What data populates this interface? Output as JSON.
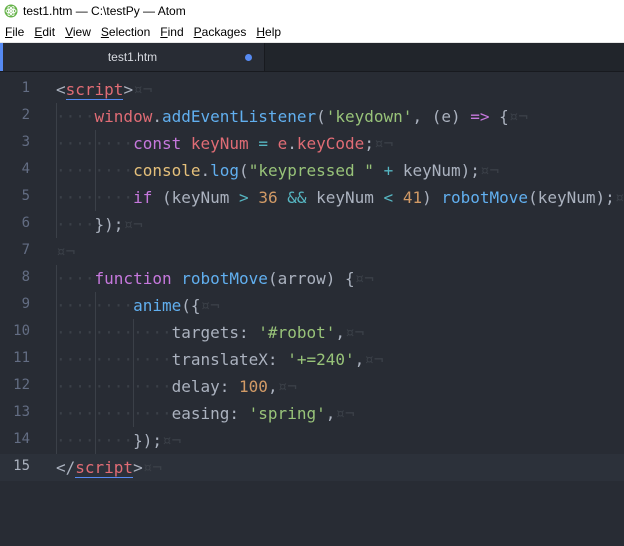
{
  "window": {
    "title": "test1.htm — C:\\testPy — Atom"
  },
  "menu": [
    {
      "mnemonic": "F",
      "rest": "ile"
    },
    {
      "mnemonic": "E",
      "rest": "dit"
    },
    {
      "mnemonic": "V",
      "rest": "iew"
    },
    {
      "mnemonic": "S",
      "rest": "election"
    },
    {
      "mnemonic": "F",
      "rest": "ind"
    },
    {
      "mnemonic": "P",
      "rest": "ackages"
    },
    {
      "mnemonic": "H",
      "rest": "elp"
    }
  ],
  "tab": {
    "label": "test1.htm",
    "modified": true
  },
  "editor": {
    "current_line": 15,
    "eol_marker": "¤¬",
    "indent_marker": "····",
    "lines": [
      {
        "n": "1",
        "indent": 0,
        "tokens": [
          [
            "p",
            "<"
          ],
          [
            "t",
            "script"
          ],
          [
            "p",
            ">"
          ]
        ]
      },
      {
        "n": "2",
        "indent": 1,
        "tokens": [
          [
            "t",
            "window"
          ],
          [
            "p",
            "."
          ],
          [
            "f",
            "addEventListener"
          ],
          [
            "p",
            "("
          ],
          [
            "s",
            "'keydown'"
          ],
          [
            "p",
            ", (e) "
          ],
          [
            "k",
            "=>"
          ],
          [
            "p",
            " {"
          ]
        ]
      },
      {
        "n": "3",
        "indent": 2,
        "tokens": [
          [
            "k",
            "const"
          ],
          [
            "p",
            " "
          ],
          [
            "t",
            "keyNum"
          ],
          [
            "p",
            " "
          ],
          [
            "o",
            "="
          ],
          [
            "p",
            " "
          ],
          [
            "t",
            "e"
          ],
          [
            "p",
            "."
          ],
          [
            "t",
            "keyCode"
          ],
          [
            "p",
            ";"
          ]
        ]
      },
      {
        "n": "4",
        "indent": 2,
        "tokens": [
          [
            "cu",
            "console"
          ],
          [
            "p",
            "."
          ],
          [
            "f",
            "log"
          ],
          [
            "p",
            "("
          ],
          [
            "s",
            "\"keypressed \""
          ],
          [
            "p",
            " "
          ],
          [
            "o",
            "+"
          ],
          [
            "p",
            " keyNum);"
          ]
        ]
      },
      {
        "n": "5",
        "indent": 2,
        "tokens": [
          [
            "k",
            "if"
          ],
          [
            "p",
            " (keyNum "
          ],
          [
            "o",
            ">"
          ],
          [
            "p",
            " "
          ],
          [
            "n",
            "36"
          ],
          [
            "p",
            " "
          ],
          [
            "o",
            "&&"
          ],
          [
            "p",
            " keyNum "
          ],
          [
            "o",
            "<"
          ],
          [
            "p",
            " "
          ],
          [
            "n",
            "41"
          ],
          [
            "p",
            ") "
          ],
          [
            "f",
            "robotMove"
          ],
          [
            "p",
            "(keyNum);"
          ]
        ]
      },
      {
        "n": "6",
        "indent": 1,
        "tokens": [
          [
            "p",
            "});"
          ]
        ]
      },
      {
        "n": "7",
        "indent": 0,
        "tokens": []
      },
      {
        "n": "8",
        "indent": 1,
        "tokens": [
          [
            "k",
            "function"
          ],
          [
            "p",
            " "
          ],
          [
            "f",
            "robotMove"
          ],
          [
            "p",
            "(arrow) {"
          ]
        ]
      },
      {
        "n": "9",
        "indent": 2,
        "tokens": [
          [
            "f",
            "anime"
          ],
          [
            "p",
            "({"
          ]
        ]
      },
      {
        "n": "10",
        "indent": 3,
        "tokens": [
          [
            "p",
            "targets: "
          ],
          [
            "s",
            "'#robot'"
          ],
          [
            "p",
            ","
          ]
        ]
      },
      {
        "n": "11",
        "indent": 3,
        "tokens": [
          [
            "p",
            "translateX: "
          ],
          [
            "s",
            "'+=240'"
          ],
          [
            "p",
            ","
          ]
        ]
      },
      {
        "n": "12",
        "indent": 3,
        "tokens": [
          [
            "p",
            "delay: "
          ],
          [
            "n",
            "100"
          ],
          [
            "p",
            ","
          ]
        ]
      },
      {
        "n": "13",
        "indent": 3,
        "tokens": [
          [
            "p",
            "easing: "
          ],
          [
            "s",
            "'spring'"
          ],
          [
            "p",
            ","
          ]
        ]
      },
      {
        "n": "14",
        "indent": 2,
        "tokens": [
          [
            "p",
            "});"
          ]
        ]
      },
      {
        "n": "15",
        "indent": 0,
        "tokens": [
          [
            "p",
            "</"
          ],
          [
            "t",
            "script"
          ],
          [
            "p",
            ">"
          ]
        ]
      }
    ]
  },
  "colors": {
    "keyword": "#c678dd",
    "tag": "#e06c75",
    "function": "#61afef",
    "string": "#98c379",
    "number": "#d19a66",
    "operator": "#56b6c2",
    "accent": "#568af2"
  }
}
